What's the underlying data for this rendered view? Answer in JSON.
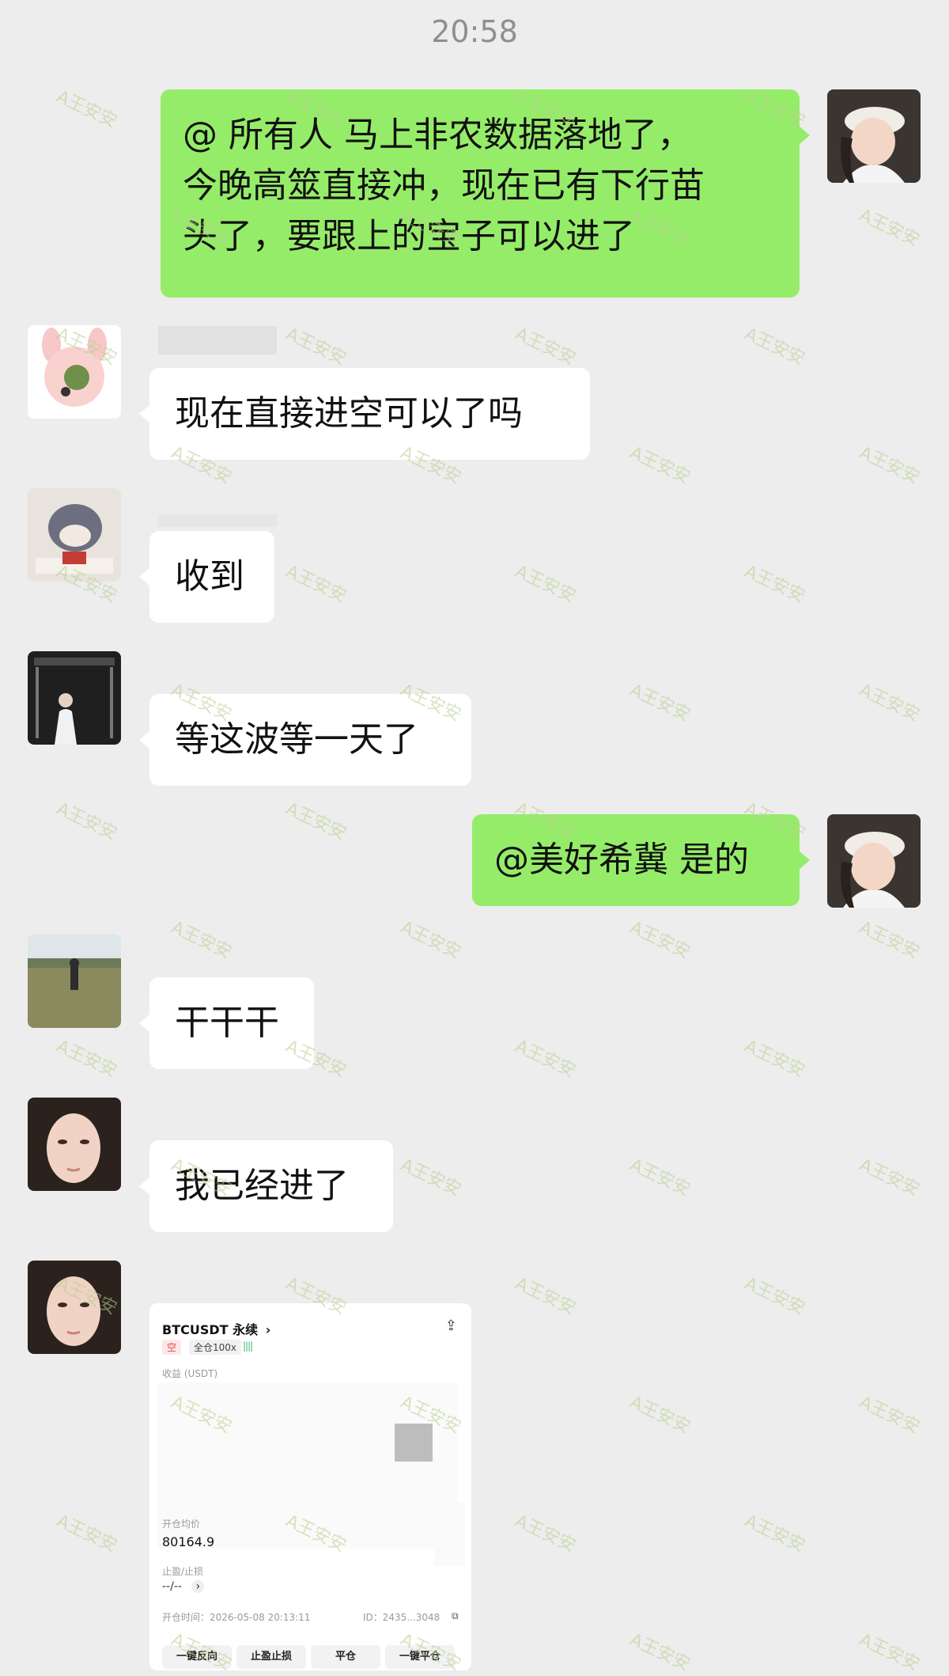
{
  "status_time": "20:58",
  "messages": [
    {
      "type": "out",
      "text_lines": [
        "@ 所有人 马上非农数据落地了，",
        "今晚高筮直接冲，现在已有下行苗",
        "头了，要跟上的宝子可以进了"
      ]
    },
    {
      "type": "in",
      "text": "现在直接进空可以了吗"
    },
    {
      "type": "in",
      "text": "收到"
    },
    {
      "type": "in",
      "text": "等这波等一天了"
    },
    {
      "type": "out",
      "text": "@美好希冀 是的"
    },
    {
      "type": "in",
      "text": "干干干"
    },
    {
      "type": "in",
      "text": "我已经进了"
    }
  ],
  "card": {
    "title": "BTCUSDT 永续",
    "chevron": "›",
    "share_icon": "share-icon",
    "tag_short": "空",
    "tag_leverage": "全仓100x",
    "bars": "||||",
    "pnl_label": "收益 (USDT)",
    "entry_label": "开仓均价",
    "entry_value": "80164.9",
    "tpsl_label": "止盈/止损",
    "tpsl_value": "--/--",
    "tpsl_chevron": "›",
    "open_time": "开仓时间：2026-05-08 20:13:11",
    "id_text": "ID：2435...3048",
    "buttons": [
      "一键反向",
      "止盈止损",
      "平仓",
      "一键平仓"
    ]
  },
  "watermark_text": "A王安安",
  "colors": {
    "out_bubble": "#95ec69",
    "in_bubble": "#ffffff",
    "background": "#ededed"
  }
}
